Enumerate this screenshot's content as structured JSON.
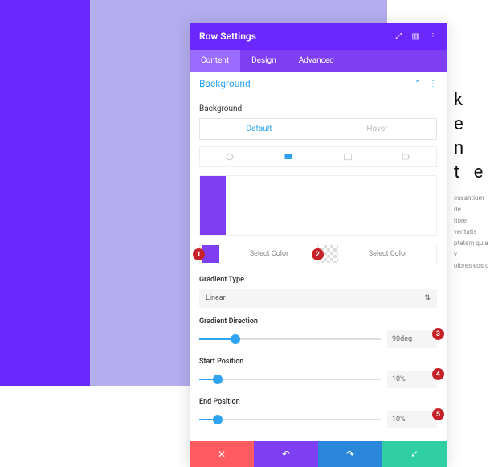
{
  "panel_title": "Row Settings",
  "tabs": {
    "content": "Content",
    "design": "Design",
    "advanced": "Advanced"
  },
  "section": {
    "title": "Background",
    "field_label": "Background"
  },
  "state_tabs": {
    "default": "Default",
    "hover": "Hover"
  },
  "color1": {
    "label": "Select Color",
    "badge": "1",
    "swatch_hex": "#7e3ff2"
  },
  "color2": {
    "label": "Select Color",
    "badge": "2"
  },
  "gradient_type": {
    "label": "Gradient Type",
    "value": "Linear"
  },
  "gradient_direction": {
    "label": "Gradient Direction",
    "value": "90deg",
    "percent": 20,
    "badge": "3"
  },
  "start_position": {
    "label": "Start Position",
    "value": "10%",
    "percent": 10,
    "badge": "4"
  },
  "end_position": {
    "label": "End Position",
    "value": "10%",
    "percent": 10,
    "badge": "5"
  },
  "bg_text": {
    "line1": "k e n",
    "line2": "t e",
    "p1": "cusantium de",
    "p2": "itore veritatis",
    "p3": "ptatem quia v",
    "p4": "olores eos q"
  }
}
